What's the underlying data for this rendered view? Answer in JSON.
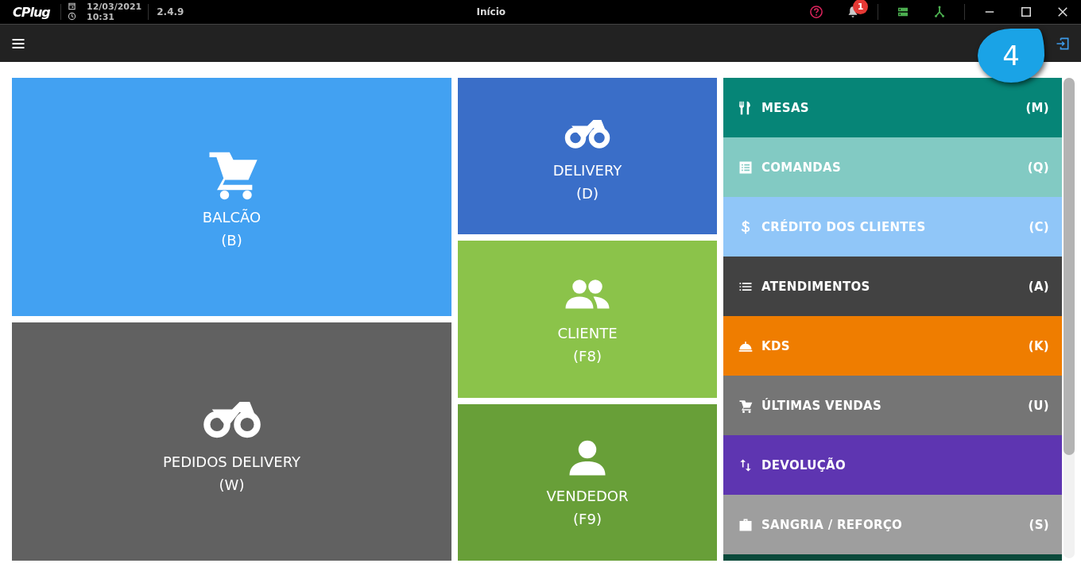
{
  "titlebar": {
    "logo": "CPlug",
    "date": "12/03/2021",
    "time": "10:31",
    "version": "2.4.9",
    "title": "Início",
    "notifications": "1"
  },
  "callout": {
    "label": "4"
  },
  "tiles_left": [
    {
      "label": "BALCÃO",
      "shortcut": "(B)",
      "color": "#42a1f2"
    },
    {
      "label": "PEDIDOS DELIVERY",
      "shortcut": "(W)",
      "color": "#616161"
    }
  ],
  "tiles_middle": [
    {
      "label": "DELIVERY",
      "shortcut": "(D)",
      "color": "#3a6ec8"
    },
    {
      "label": "CLIENTE",
      "shortcut": "(F8)",
      "color": "#8bc34a"
    },
    {
      "label": "VENDEDOR",
      "shortcut": "(F9)",
      "color": "#689f38"
    }
  ],
  "menu": [
    {
      "label": "MESAS",
      "shortcut": "(M)",
      "color": "#068577"
    },
    {
      "label": "COMANDAS",
      "shortcut": "(Q)",
      "color": "#82cac3"
    },
    {
      "label": "CRÉDITO DOS CLIENTES",
      "shortcut": "(C)",
      "color": "#90c6f8"
    },
    {
      "label": "ATENDIMENTOS",
      "shortcut": "(A)",
      "color": "#424242"
    },
    {
      "label": "KDS",
      "shortcut": "(K)",
      "color": "#ef7d00"
    },
    {
      "label": "ÚLTIMAS VENDAS",
      "shortcut": "(U)",
      "color": "#757575"
    },
    {
      "label": "DEVOLUÇÃO",
      "color": "#5e35b1"
    },
    {
      "label": "SANGRIA / REFORÇO",
      "shortcut": "(S)",
      "color": "#9e9e9e"
    },
    {
      "color": "#0b4a3b"
    }
  ]
}
